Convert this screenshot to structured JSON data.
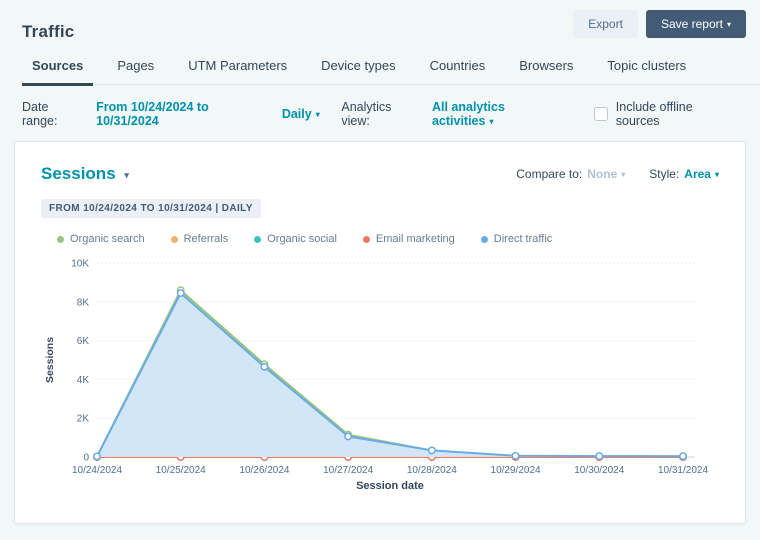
{
  "page": {
    "title": "Traffic"
  },
  "header": {
    "export_label": "Export",
    "save_report_label": "Save report"
  },
  "tabs": [
    {
      "label": "Sources",
      "active": true
    },
    {
      "label": "Pages",
      "active": false
    },
    {
      "label": "UTM Parameters",
      "active": false
    },
    {
      "label": "Device types",
      "active": false
    },
    {
      "label": "Countries",
      "active": false
    },
    {
      "label": "Browsers",
      "active": false
    },
    {
      "label": "Topic clusters",
      "active": false
    }
  ],
  "filters": {
    "date_range_label": "Date range:",
    "date_range_value": "From 10/24/2024 to 10/31/2024",
    "frequency_value": "Daily",
    "analytics_view_label": "Analytics view:",
    "analytics_view_value": "All analytics activities",
    "offline_label": "Include offline sources",
    "offline_checked": false
  },
  "report": {
    "title": "Sessions",
    "compare_label": "Compare to:",
    "compare_value": "None",
    "style_label": "Style:",
    "style_value": "Area",
    "range_badge": "FROM 10/24/2024 TO 10/31/2024 | DAILY"
  },
  "colors": {
    "accent_teal": "#0091ae",
    "dark_navy": "#33475b",
    "axis_text": "#516f90",
    "grid_line": "#d6dfe8",
    "axis_line": "#cbd6e2"
  },
  "chart_data": {
    "type": "area",
    "x": [
      "10/24/2024",
      "10/25/2024",
      "10/26/2024",
      "10/27/2024",
      "10/28/2024",
      "10/29/2024",
      "10/30/2024",
      "10/31/2024"
    ],
    "series": [
      {
        "name": "Organic search",
        "color": "#97c57f",
        "fill": "#e7f2df",
        "values": [
          20,
          8600,
          4780,
          1150,
          330,
          50,
          40,
          35
        ]
      },
      {
        "name": "Referrals",
        "color": "#f0b268",
        "fill": "#fdf3e6",
        "values": [
          0,
          0,
          0,
          0,
          0,
          0,
          0,
          0
        ]
      },
      {
        "name": "Organic social",
        "color": "#3cc1c1",
        "fill": "#e2f6f6",
        "values": [
          0,
          0,
          0,
          0,
          0,
          0,
          0,
          0
        ]
      },
      {
        "name": "Email marketing",
        "color": "#f07662",
        "fill": "#fdeae7",
        "values": [
          0,
          0,
          0,
          0,
          0,
          0,
          0,
          0
        ]
      },
      {
        "name": "Direct traffic",
        "color": "#6aabe4",
        "fill": "#d2e6f8",
        "values": [
          30,
          8450,
          4650,
          1060,
          340,
          60,
          45,
          40
        ]
      }
    ],
    "title": "Sessions",
    "xlabel": "Session date",
    "ylabel": "Sessions",
    "ylim": [
      0,
      10000
    ],
    "yticks": [
      {
        "v": 0,
        "label": "0"
      },
      {
        "v": 2000,
        "label": "2K"
      },
      {
        "v": 4000,
        "label": "4K"
      },
      {
        "v": 6000,
        "label": "6K"
      },
      {
        "v": 8000,
        "label": "8K"
      },
      {
        "v": 10000,
        "label": "10K"
      }
    ],
    "grid": true,
    "legend_position": "top"
  }
}
